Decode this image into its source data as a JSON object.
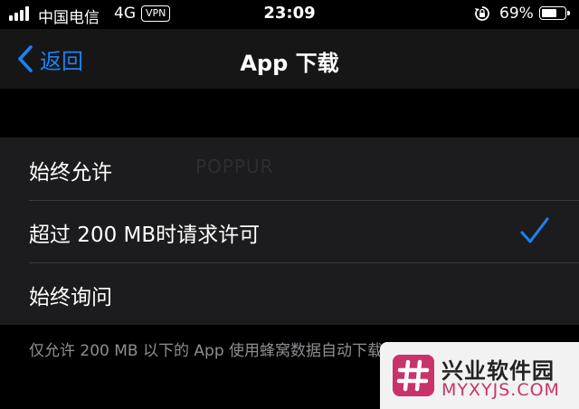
{
  "status_bar": {
    "carrier": "中国电信",
    "network": "4G",
    "vpn": "VPN",
    "time": "23:09",
    "battery_percent": "69%",
    "battery_level": 0.69
  },
  "nav": {
    "back_label": "返回",
    "title": "App 下载"
  },
  "options": [
    {
      "label": "始终允许",
      "selected": false
    },
    {
      "label": "超过 200 MB时请求许可",
      "selected": true
    },
    {
      "label": "始终询问",
      "selected": false
    }
  ],
  "watermark": "POPPUR",
  "footer_note": "仅允许 200 MB 以下的 App 使用蜂窝数据自动下载",
  "site_logo": {
    "name_cn": "兴业软件园",
    "name_en": "MYXYJS.COM"
  },
  "colors": {
    "accent": "#1a82f6",
    "background": "#000000",
    "group_background": "#1c1c1e",
    "logo": "#c8336b"
  },
  "icons": {
    "back": "chevron-left-icon",
    "check": "checkmark-icon",
    "signal": "signal-bars-icon",
    "rotation_lock": "rotation-lock-icon",
    "battery": "battery-icon"
  }
}
